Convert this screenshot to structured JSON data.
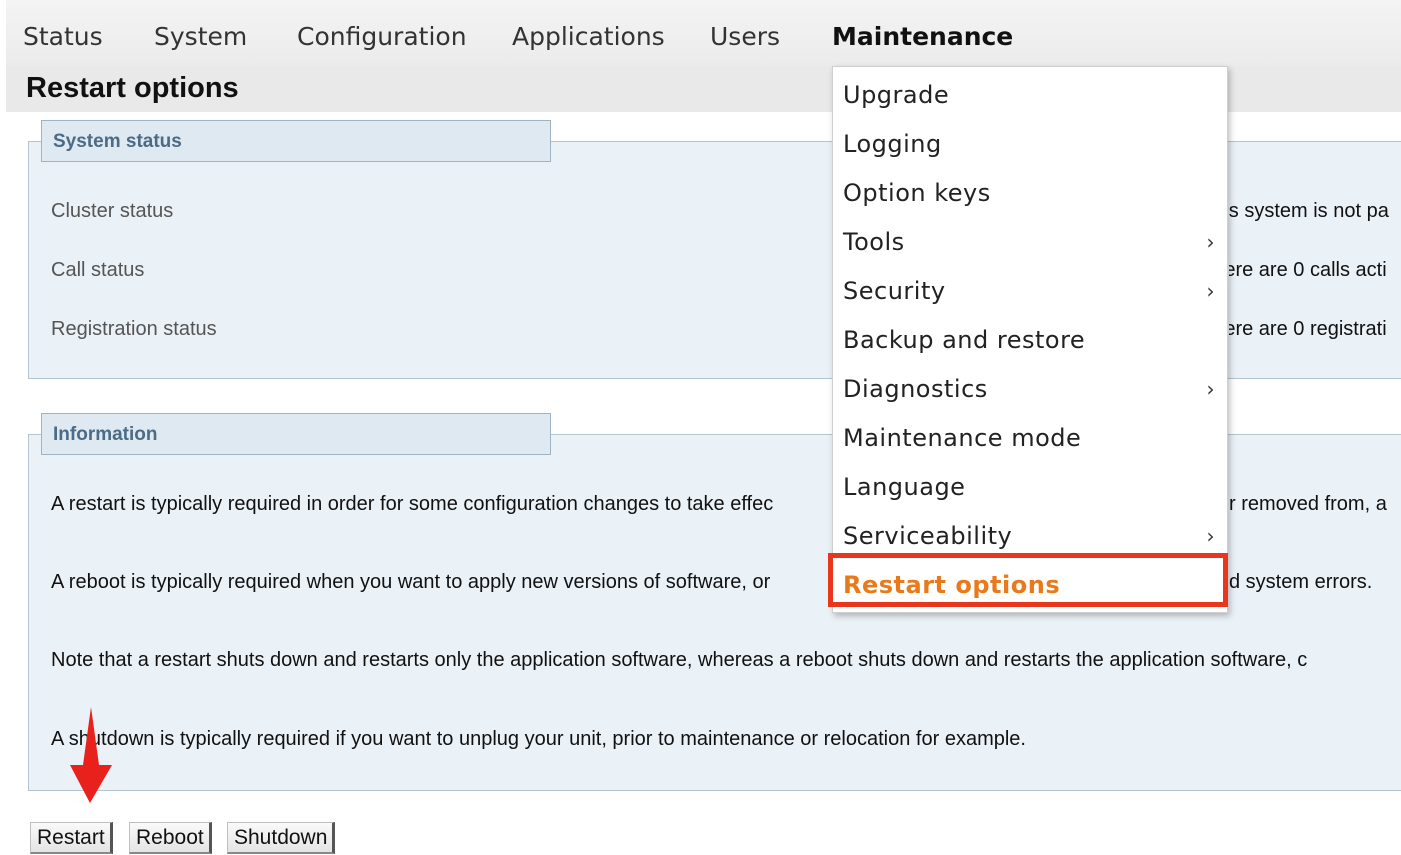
{
  "nav": {
    "items": [
      {
        "label": "Status"
      },
      {
        "label": "System"
      },
      {
        "label": "Configuration"
      },
      {
        "label": "Applications"
      },
      {
        "label": "Users"
      },
      {
        "label": "Maintenance"
      }
    ],
    "active": "Maintenance"
  },
  "page": {
    "title": "Restart options"
  },
  "system_status": {
    "legend": "System status",
    "rows": [
      {
        "label": "Cluster status",
        "value": "This system is not pa"
      },
      {
        "label": "Call status",
        "value": "There are 0 calls acti"
      },
      {
        "label": "Registration status",
        "value": "There are 0 registrati"
      }
    ]
  },
  "information": {
    "legend": "Information",
    "paragraphs": [
      "A restart is typically required in order for some configuration changes to take effec",
      "A reboot is typically required when you want to apply new versions of software, or",
      "Note that a restart shuts down and restarts only the application software, whereas a reboot shuts down and restarts the application software, c",
      "A shutdown is typically required if you want to unplug your unit, prior to maintenance or relocation for example."
    ],
    "para_tails": [
      "r removed from, a",
      "d system errors."
    ]
  },
  "buttons": {
    "restart": "Restart",
    "reboot": "Reboot",
    "shutdown": "Shutdown"
  },
  "menu": {
    "items": [
      {
        "label": "Upgrade",
        "submenu": false
      },
      {
        "label": "Logging",
        "submenu": false
      },
      {
        "label": "Option keys",
        "submenu": false
      },
      {
        "label": "Tools",
        "submenu": true
      },
      {
        "label": "Security",
        "submenu": true
      },
      {
        "label": "Backup and restore",
        "submenu": false
      },
      {
        "label": "Diagnostics",
        "submenu": true
      },
      {
        "label": "Maintenance mode",
        "submenu": false
      },
      {
        "label": "Language",
        "submenu": false
      },
      {
        "label": "Serviceability",
        "submenu": true
      },
      {
        "label": "Restart options",
        "submenu": false
      }
    ],
    "selected": "Restart options",
    "chevron": "›"
  },
  "colors": {
    "highlight_text": "#e87a1c",
    "highlight_box": "#e8371c",
    "annotation_arrow": "#e8211c",
    "section_bg": "#eaf1f7",
    "legend_text": "#4b6b86"
  },
  "icons": {
    "submenu": "chevron-right-icon",
    "annotation": "red-arrow-icon"
  }
}
